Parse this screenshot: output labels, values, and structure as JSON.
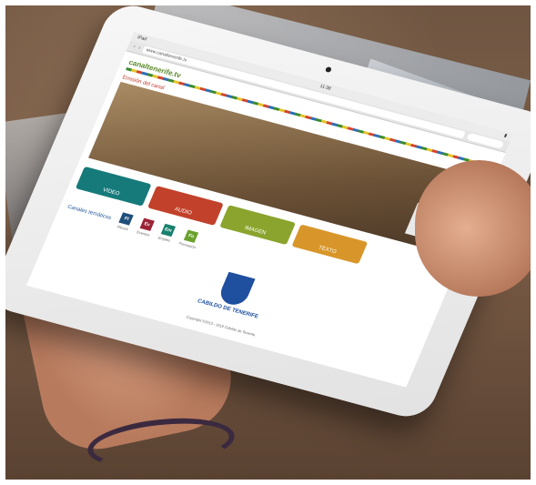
{
  "browser": {
    "status_left": "iPad",
    "status_time": "11:38",
    "url": "www.canaltenerife.tv"
  },
  "site": {
    "logo": "canaltenerife.tv",
    "live_title": "Emisión del canal",
    "tiles": [
      "VIDEO",
      "AUDIO",
      "IMAGEN",
      "TEXTO"
    ],
    "channels_label": "Canales temáticos",
    "channels": [
      {
        "code": "Pl",
        "name": "Plenos"
      },
      {
        "code": "Ev",
        "name": "Eventos"
      },
      {
        "code": "Em",
        "name": "Empleo"
      },
      {
        "code": "Fo",
        "name": "Formación"
      }
    ],
    "seal_text": "CABILDO DE TENERIFE",
    "copyright": "Copyright ©2013 - 2015 Cabildo de Tenerife"
  }
}
